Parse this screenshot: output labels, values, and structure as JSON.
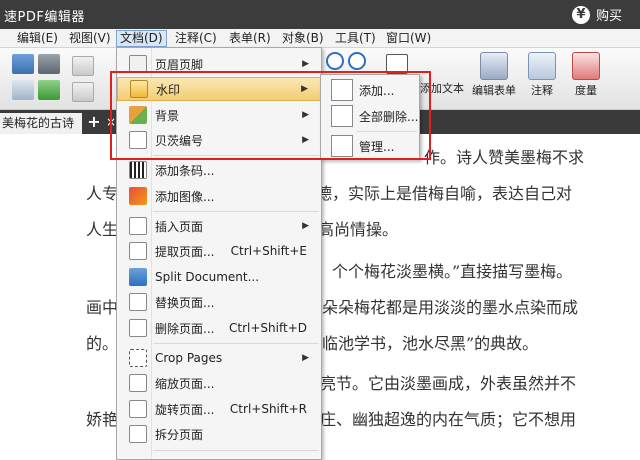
{
  "app": {
    "title": "速PDF编辑器",
    "buy_label": "购买",
    "buy_icon": "yen-icon"
  },
  "menubar": {
    "items": [
      {
        "label": "编辑(E)",
        "active": false
      },
      {
        "label": "视图(V)",
        "active": false
      },
      {
        "label": "文档(D)",
        "active": true
      },
      {
        "label": "注释(C)",
        "active": false
      },
      {
        "label": "表单(R)",
        "active": false
      },
      {
        "label": "对象(B)",
        "active": false
      },
      {
        "label": "工具(T)",
        "active": false
      },
      {
        "label": "窗口(W)",
        "active": false
      }
    ]
  },
  "toolbar": {
    "add_text": "添加文本",
    "edit_form": "编辑表单",
    "annotate": "注释",
    "measure": "度量"
  },
  "tabs": {
    "active_tab": "美梅花的古诗",
    "add": "+",
    "close": "×"
  },
  "document": {
    "lines": [
      "作。诗人赞美墨梅不求",
      "人专",
      "德，实际上是借梅自喻，表达自己对",
      "人生",
      "高尚情操。",
      "个个梅花淡墨横。”直接描写墨梅。",
      "画中",
      "朵朵梅花都是用淡淡的墨水点染而成",
      "的。",
      "临池学书，池水尽黑”的典故。",
      "亮节。它由淡墨画成，外表虽然并不",
      "娇艳",
      "庄、幽独超逸的内在气质；它不想用"
    ]
  },
  "dropdown": {
    "items": [
      {
        "label": "页眉页脚",
        "shortcut": "",
        "submenu": true,
        "highlight": false
      },
      {
        "label": "水印",
        "shortcut": "",
        "submenu": true,
        "highlight": true
      },
      {
        "label": "背景",
        "shortcut": "",
        "submenu": true,
        "highlight": false
      },
      {
        "label": "贝茨编号",
        "shortcut": "",
        "submenu": true,
        "highlight": false
      },
      {
        "label": "添加条码...",
        "shortcut": "",
        "submenu": false,
        "highlight": false
      },
      {
        "label": "添加图像...",
        "shortcut": "",
        "submenu": false,
        "highlight": false
      },
      {
        "label": "插入页面",
        "shortcut": "",
        "submenu": true,
        "highlight": false
      },
      {
        "label": "提取页面...",
        "shortcut": "Ctrl+Shift+E",
        "submenu": false,
        "highlight": false
      },
      {
        "label": "Split Document...",
        "shortcut": "",
        "submenu": false,
        "highlight": false
      },
      {
        "label": "替换页面...",
        "shortcut": "",
        "submenu": false,
        "highlight": false
      },
      {
        "label": "删除页面...",
        "shortcut": "Ctrl+Shift+D",
        "submenu": false,
        "highlight": false
      },
      {
        "label": "Crop Pages",
        "shortcut": "",
        "submenu": true,
        "highlight": false
      },
      {
        "label": "缩放页面...",
        "shortcut": "",
        "submenu": false,
        "highlight": false
      },
      {
        "label": "旋转页面...",
        "shortcut": "Ctrl+Shift+R",
        "submenu": false,
        "highlight": false
      },
      {
        "label": "拆分页面",
        "shortcut": "",
        "submenu": false,
        "highlight": false
      }
    ]
  },
  "submenu": {
    "items": [
      {
        "label": "添加..."
      },
      {
        "label": "全部删除..."
      },
      {
        "label": "管理..."
      }
    ]
  },
  "colors": {
    "highlight_box": "#e02020",
    "menu_highlight": "#f3cd74",
    "titlebar": "#3c3c3c"
  }
}
